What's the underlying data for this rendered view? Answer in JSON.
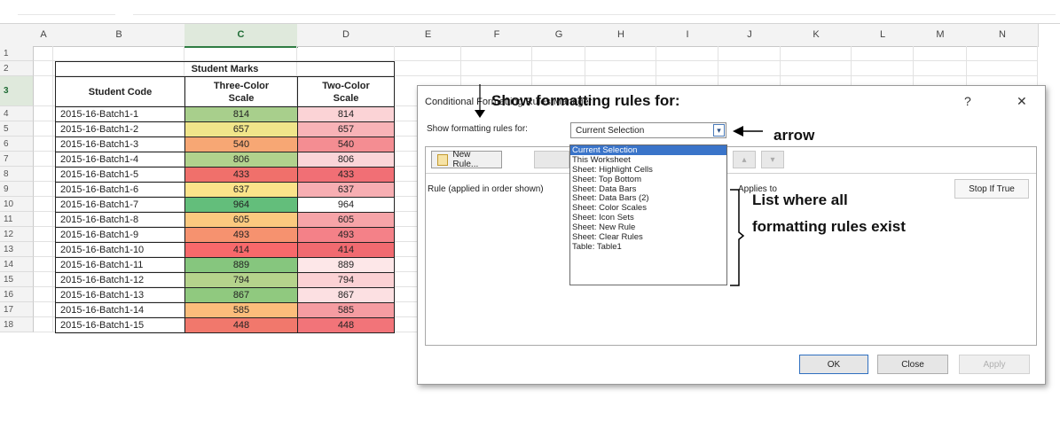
{
  "spreadsheet": {
    "columns": [
      "A",
      "B",
      "C",
      "D",
      "E",
      "F",
      "G",
      "H",
      "I",
      "J",
      "K",
      "L",
      "M",
      "N"
    ],
    "selected_column": "C",
    "rows": [
      "1",
      "2",
      "3",
      "4",
      "5",
      "6",
      "7",
      "8",
      "9",
      "10",
      "11",
      "12",
      "13",
      "14",
      "15",
      "16",
      "17",
      "18"
    ],
    "selected_row": "3"
  },
  "table": {
    "title": "Student Marks",
    "headers": {
      "code": "Student Code",
      "three": "Three-Color\nScale",
      "two": "Two-Color\nScale"
    },
    "rows": [
      {
        "code": "2015-16-Batch1-1",
        "value": 814,
        "c3": "#a8cf8c",
        "c2": "#fbd3d6"
      },
      {
        "code": "2015-16-Batch1-2",
        "value": 657,
        "c3": "#f0e58a",
        "c2": "#f8b3b7"
      },
      {
        "code": "2015-16-Batch1-3",
        "value": 540,
        "c3": "#f7a774",
        "c2": "#f48d92"
      },
      {
        "code": "2015-16-Batch1-4",
        "value": 806,
        "c3": "#b1d28d",
        "c2": "#fbd5d8"
      },
      {
        "code": "2015-16-Batch1-5",
        "value": 433,
        "c3": "#f0706b",
        "c2": "#f16f75"
      },
      {
        "code": "2015-16-Batch1-6",
        "value": 637,
        "c3": "#fce38a",
        "c2": "#f7aeb2"
      },
      {
        "code": "2015-16-Batch1-7",
        "value": 964,
        "c3": "#63be7b",
        "c2": "#ffffff"
      },
      {
        "code": "2015-16-Batch1-8",
        "value": 605,
        "c3": "#fbc97f",
        "c2": "#f6a4a8"
      },
      {
        "code": "2015-16-Batch1-9",
        "value": 493,
        "c3": "#f6926f",
        "c2": "#f48188"
      },
      {
        "code": "2015-16-Batch1-10",
        "value": 414,
        "c3": "#f8696b",
        "c2": "#f16a70"
      },
      {
        "code": "2015-16-Batch1-11",
        "value": 889,
        "c3": "#86c67e",
        "c2": "#fde7e8"
      },
      {
        "code": "2015-16-Batch1-12",
        "value": 794,
        "c3": "#b5d38c",
        "c2": "#fbd1d4"
      },
      {
        "code": "2015-16-Batch1-13",
        "value": 867,
        "c3": "#90c97f",
        "c2": "#fce0e2"
      },
      {
        "code": "2015-16-Batch1-14",
        "value": 585,
        "c3": "#fbbd7b",
        "c2": "#f59ca1"
      },
      {
        "code": "2015-16-Batch1-15",
        "value": 448,
        "c3": "#f1786c",
        "c2": "#f27479"
      }
    ]
  },
  "dialog": {
    "title": "Conditional Formatting Rules Manager",
    "help": "?",
    "close": "✕",
    "show_rules_label": "Show formatting rules for:",
    "combo_value": "Current Selection",
    "new_rule": "New Rule...",
    "rule_col": "Rule (applied in order shown)",
    "applies_to": "Applies to",
    "stop_if_true": "Stop If True",
    "ok": "OK",
    "close_btn": "Close",
    "apply": "Apply",
    "options": [
      "Current Selection",
      "This Worksheet",
      "Sheet: Highlight Cells",
      "Sheet: Top  Bottom",
      "Sheet: Data Bars",
      "Sheet: Data Bars (2)",
      "Sheet: Color Scales",
      "Sheet: Icon Sets",
      "Sheet: New Rule",
      "Sheet: Clear Rules",
      "Table: Table1"
    ]
  },
  "annotations": {
    "show_rules": "Show formatting rules for:",
    "arrow": "arrow",
    "list_line1": "List where all",
    "list_line2": "formatting rules exist"
  }
}
